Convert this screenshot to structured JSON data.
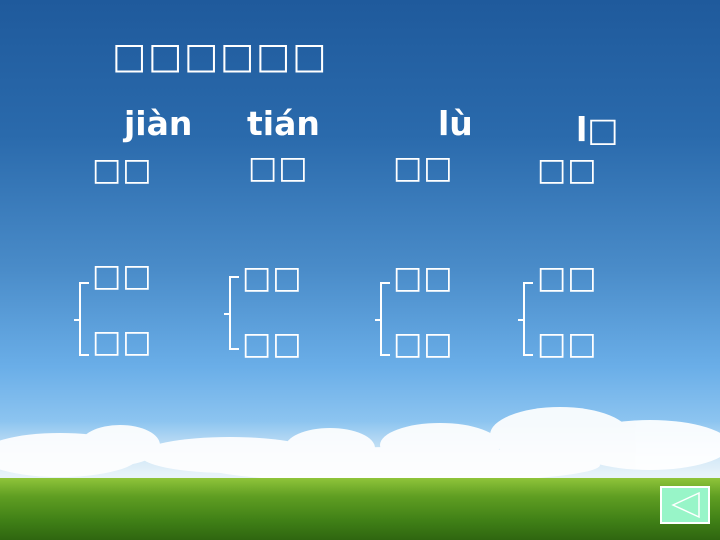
{
  "title": "□□□□□□",
  "columns": [
    {
      "pinyin": "jiàn",
      "word": "□□",
      "upper": "□□",
      "lower": "□□"
    },
    {
      "pinyin": "tián",
      "word": "□□",
      "upper": "□□",
      "lower": "□□"
    },
    {
      "pinyin": "lù",
      "word": "□□",
      "upper": "□□",
      "lower": "□□"
    },
    {
      "pinyin": "l□",
      "word": "□□",
      "upper": "□□",
      "lower": "□□"
    }
  ],
  "nav": {
    "back_icon": "triangle-left-icon",
    "color": "#98f5c8"
  }
}
